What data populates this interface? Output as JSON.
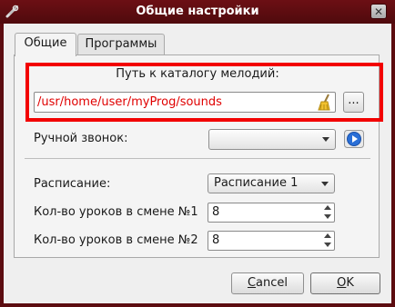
{
  "window": {
    "title": "Общие настройки",
    "close_glyph": "✕"
  },
  "tabs": [
    {
      "label": "Общие",
      "active": true
    },
    {
      "label": "Программы",
      "active": false
    }
  ],
  "melody_dir": {
    "label": "Путь к каталогу мелодий:",
    "value": "/usr/home/user/myProg/sounds",
    "browse_label": "...",
    "highlight_color": "#f20000"
  },
  "manual_bell": {
    "label": "Ручной звонок:",
    "selected": ""
  },
  "schedule": {
    "label": "Расписание:",
    "selected": "Расписание 1"
  },
  "lessons_shift1": {
    "label": "Кол-во уроков в смене №1",
    "value": "8"
  },
  "lessons_shift2": {
    "label": "Кол-во уроков в смене №2",
    "value": "8"
  },
  "buttons": {
    "cancel_first": "C",
    "cancel_rest": "ancel",
    "ok_first": "O",
    "ok_rest": "K"
  },
  "colors": {
    "titlebar": "#6c0f14",
    "accent_blue": "#2a6fd6"
  }
}
